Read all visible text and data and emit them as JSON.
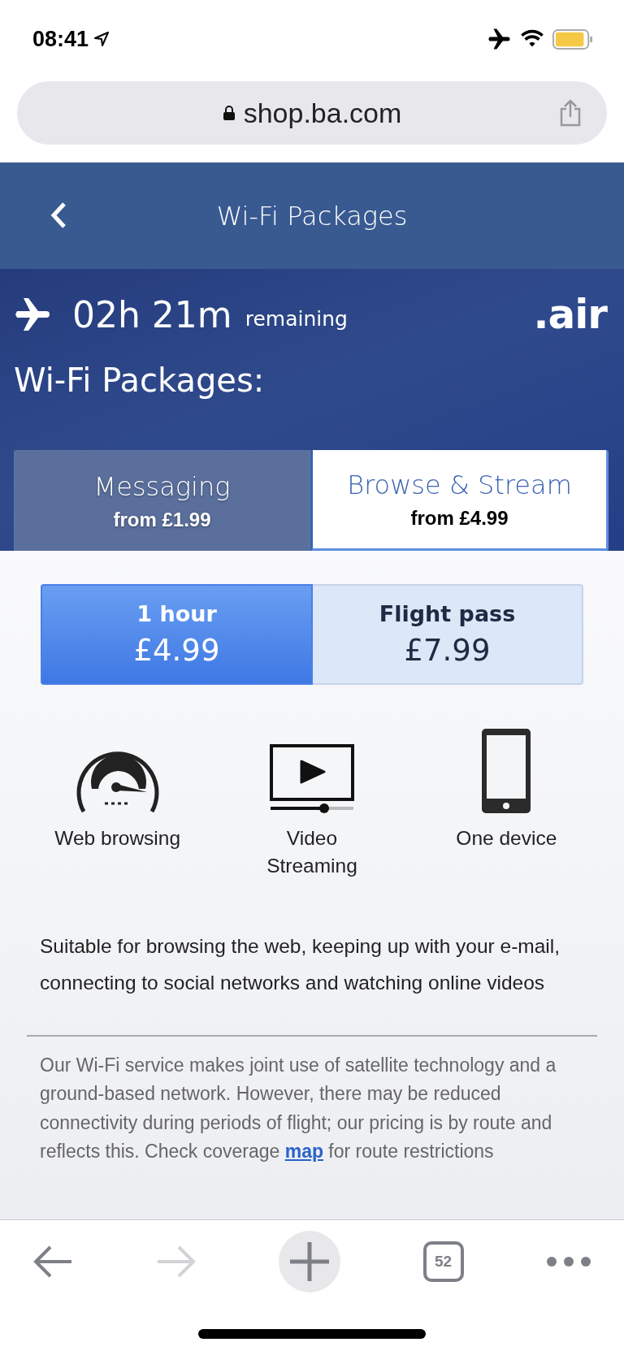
{
  "status_bar": {
    "time": "08:41"
  },
  "browser": {
    "url": "shop.ba.com"
  },
  "header": {
    "title": "Wi-Fi Packages"
  },
  "flight": {
    "time_left": "02h 21m",
    "suffix": "remaining",
    "brand": ".air"
  },
  "heading": "Wi-Fi Packages:",
  "package_tabs": [
    {
      "name": "Messaging",
      "price": "from £1.99",
      "selected": false
    },
    {
      "name": "Browse & Stream",
      "price": "from £4.99",
      "selected": true
    }
  ],
  "durations": [
    {
      "label": "1 hour",
      "price": "£4.99",
      "selected": true
    },
    {
      "label": "Flight pass",
      "price": "£7.99",
      "selected": false
    }
  ],
  "features": [
    {
      "kind": "speedometer",
      "label": "Web browsing"
    },
    {
      "kind": "video",
      "label": "Video Streaming"
    },
    {
      "kind": "phone",
      "label": "One device"
    }
  ],
  "description": "Suitable for browsing the web, keeping up with your e-mail, connecting to social networks and watching online videos",
  "notice": {
    "before": "Our Wi-Fi service makes joint use of satellite technology and a ground-based network. However, there may be reduced connectivity during periods of flight; our pricing is by route and reflects this. Check coverage ",
    "link": "map",
    "after": " for route restrictions"
  },
  "toolbar": {
    "tab_count": "52",
    "forward_disabled": true
  }
}
